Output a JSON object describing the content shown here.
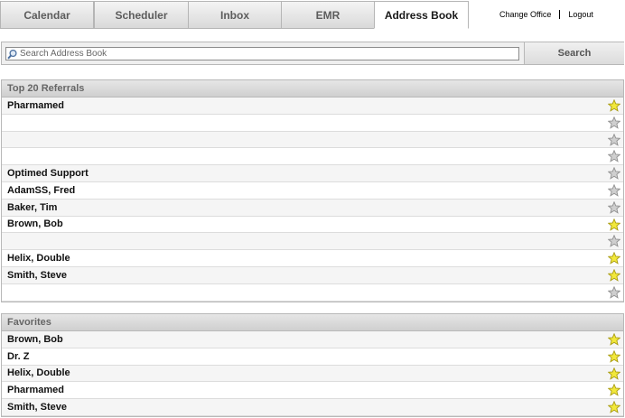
{
  "tabs": [
    {
      "label": "Calendar",
      "active": false
    },
    {
      "label": "Scheduler",
      "active": false
    },
    {
      "label": "Inbox",
      "active": false
    },
    {
      "label": "EMR",
      "active": false
    },
    {
      "label": "Address Book",
      "active": true
    }
  ],
  "links": {
    "change_office": "Change Office",
    "logout": "Logout"
  },
  "search": {
    "placeholder": "Search Address Book",
    "value": "",
    "button_label": "Search"
  },
  "referrals": {
    "title": "Top 20 Referrals",
    "items": [
      {
        "name": "Pharmamed",
        "favorite": true
      },
      {
        "name": "",
        "favorite": false
      },
      {
        "name": "",
        "favorite": false
      },
      {
        "name": "",
        "favorite": false
      },
      {
        "name": "Optimed Support",
        "favorite": false
      },
      {
        "name": "AdamSS, Fred",
        "favorite": false
      },
      {
        "name": "Baker, Tim",
        "favorite": false
      },
      {
        "name": "Brown, Bob",
        "favorite": true
      },
      {
        "name": "",
        "favorite": false
      },
      {
        "name": "Helix, Double",
        "favorite": true
      },
      {
        "name": "Smith, Steve",
        "favorite": true
      },
      {
        "name": "",
        "favorite": false
      }
    ]
  },
  "favorites": {
    "title": "Favorites",
    "items": [
      {
        "name": "Brown, Bob",
        "favorite": true
      },
      {
        "name": "Dr. Z",
        "favorite": true
      },
      {
        "name": "Helix, Double",
        "favorite": true
      },
      {
        "name": "Pharmamed",
        "favorite": true
      },
      {
        "name": "Smith, Steve",
        "favorite": true
      }
    ]
  },
  "colors": {
    "star_on": "#f2e83a",
    "star_off": "#cfcfcf"
  }
}
